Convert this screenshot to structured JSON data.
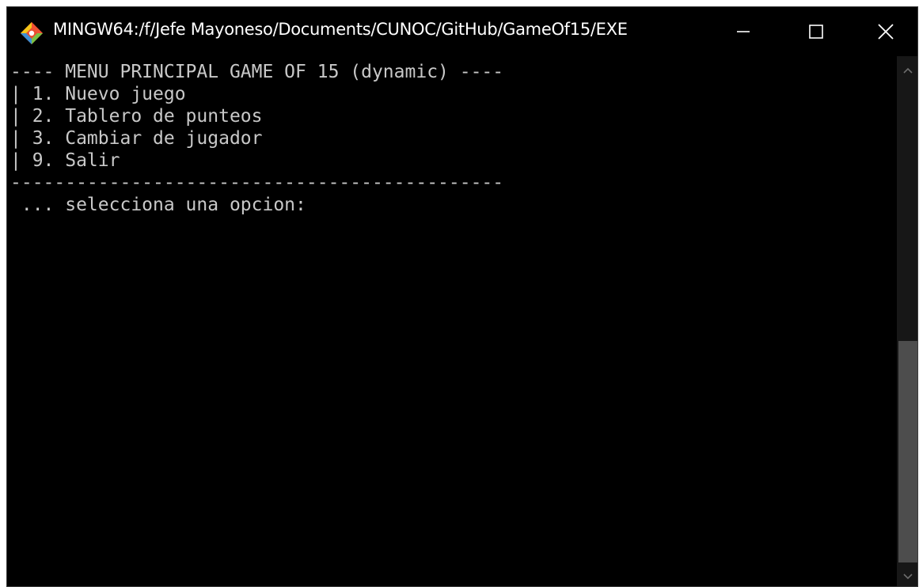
{
  "window": {
    "title": "MINGW64:/f/Jefe Mayoneso/Documents/CUNOC/GitHub/GameOf15/EXE",
    "icon": "git-bash-icon",
    "controls": {
      "minimize_icon": "minimize-icon",
      "maximize_icon": "maximize-icon",
      "close_icon": "close-icon"
    }
  },
  "terminal": {
    "lines": [
      "---- MENU PRINCIPAL GAME OF 15 (dynamic) ----",
      "| 1. Nuevo juego",
      "| 2. Tablero de punteos",
      "| 3. Cambiar de jugador",
      "| 9. Salir",
      "---------------------------------------------",
      " ... selecciona una opcion:"
    ]
  },
  "colors": {
    "background": "#000000",
    "text": "#c8c8c8",
    "scrollbar_thumb": "#4d4d4d"
  }
}
